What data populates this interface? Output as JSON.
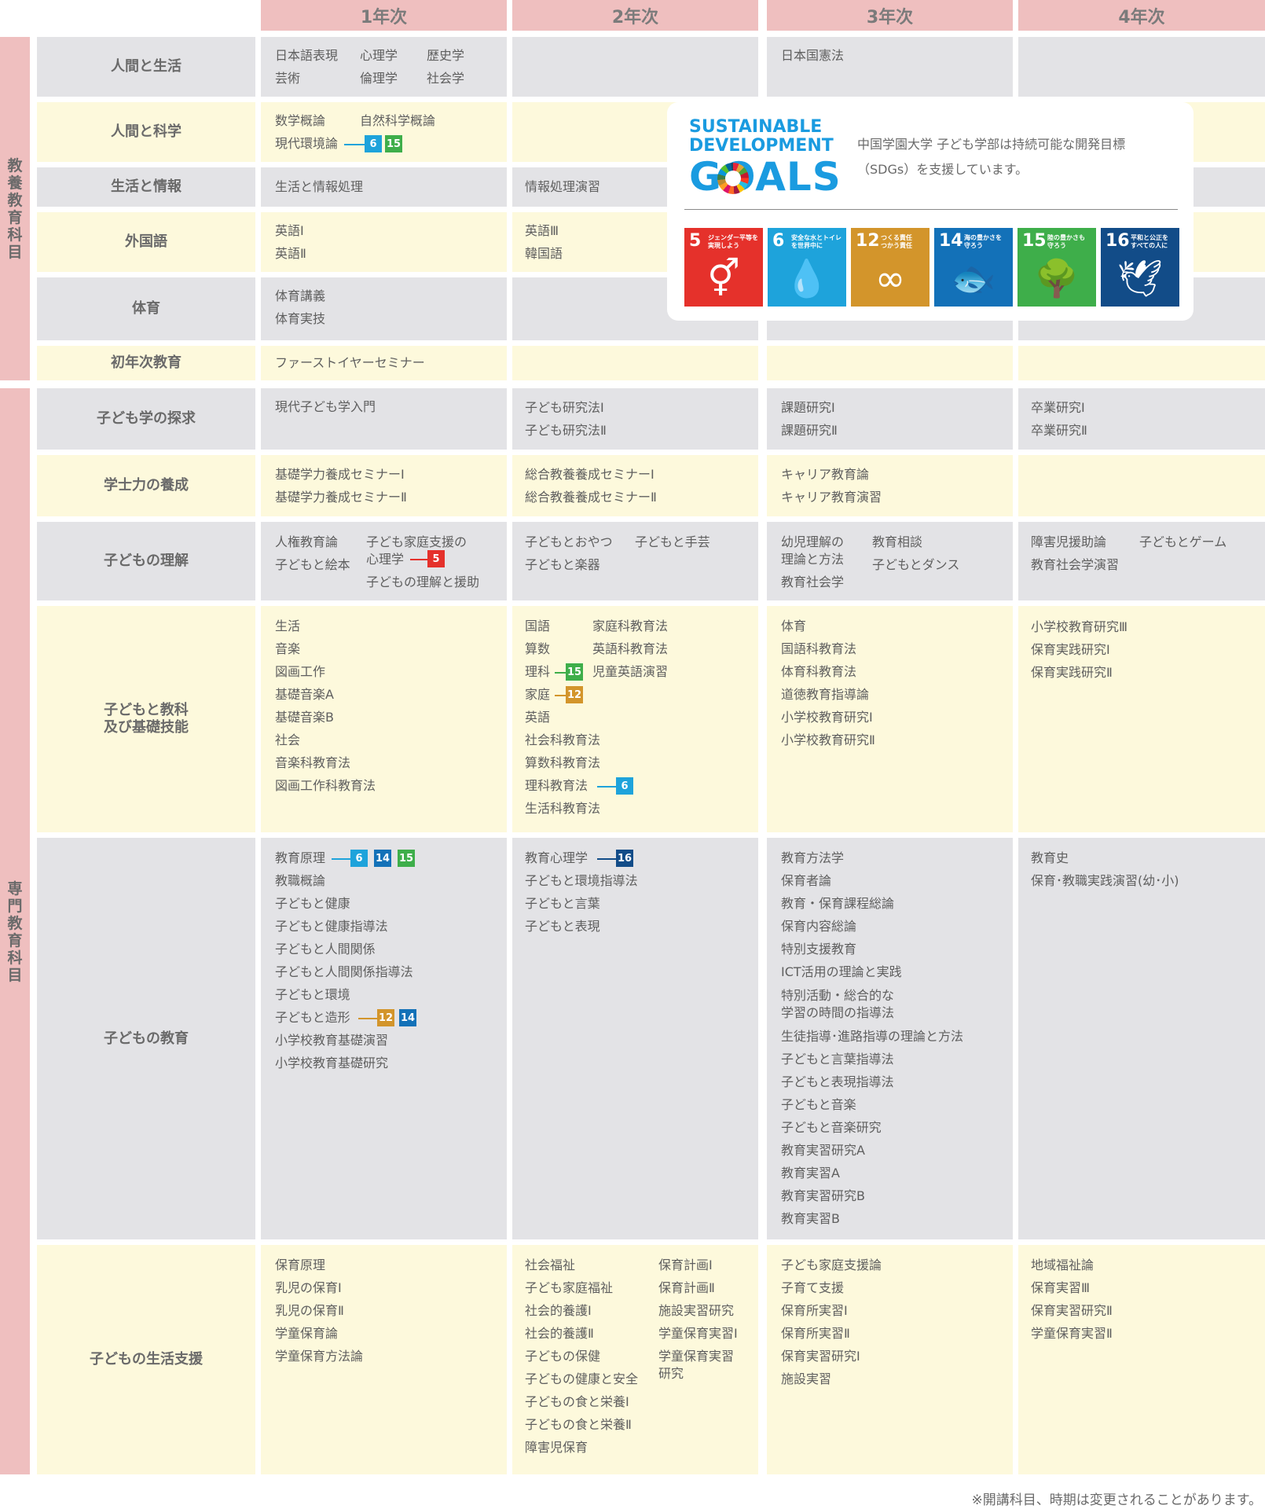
{
  "years": [
    "1年次",
    "2年次",
    "3年次",
    "4年次"
  ],
  "groups": [
    {
      "label": "教養教育科目",
      "chars": [
        "教",
        "養",
        "教",
        "育",
        "科",
        "目"
      ]
    },
    {
      "label": "専門教育科目",
      "chars": [
        "専",
        "門",
        "教",
        "育",
        "科",
        "目"
      ]
    }
  ],
  "categories": [
    "人間と生活",
    "人間と科学",
    "生活と情報",
    "外国語",
    "体育",
    "初年次教育",
    "子ども学の探求",
    "学士力の養成",
    "子どもの理解",
    "子どもと教科",
    "及び基礎技能",
    "子どもの教育",
    "子どもの生活支援"
  ],
  "cells": {
    "r1y1": [
      "日本語表現",
      "心理学",
      "歴史学",
      "芸術",
      "倫理学",
      "社会学"
    ],
    "r1y3": [
      "日本国憲法"
    ],
    "r2y1": [
      "数学概論",
      "自然科学概論",
      "現代環境論"
    ],
    "r3y1": [
      "生活と情報処理"
    ],
    "r3y2": [
      "情報処理演習"
    ],
    "r4y1": [
      "英語Ⅰ",
      "英語Ⅱ"
    ],
    "r4y2": [
      "英語Ⅲ",
      "韓国語"
    ],
    "r5y1": [
      "体育講義",
      "体育実技"
    ],
    "r6y1": [
      "ファーストイヤーセミナー"
    ],
    "r7y1": [
      "現代子ども学入門"
    ],
    "r7y2": [
      "子ども研究法Ⅰ",
      "子ども研究法Ⅱ"
    ],
    "r7y3": [
      "課題研究Ⅰ",
      "課題研究Ⅱ"
    ],
    "r7y4": [
      "卒業研究Ⅰ",
      "卒業研究Ⅱ"
    ],
    "r8y1": [
      "基礎学力養成セミナーⅠ",
      "基礎学力養成セミナーⅡ"
    ],
    "r8y2": [
      "総合教養養成セミナーⅠ",
      "総合教養養成セミナーⅡ"
    ],
    "r8y3": [
      "キャリア教育論",
      "キャリア教育演習"
    ],
    "r9y1": [
      "人権教育論",
      "子ども家庭支援の",
      "子どもと絵本",
      "心理学",
      "子どもの理解と援助"
    ],
    "r9y2": [
      "子どもとおやつ",
      "子どもと手芸",
      "子どもと楽器"
    ],
    "r9y3": [
      "幼児理解の",
      "教育相談",
      "理論と方法",
      "子どもとダンス",
      "教育社会学"
    ],
    "r9y4": [
      "障害児援助論",
      "子どもとゲーム",
      "教育社会学演習"
    ],
    "r10y1": [
      "生活",
      "音楽",
      "図画工作",
      "基礎音楽A",
      "基礎音楽B",
      "社会",
      "音楽科教育法",
      "図画工作科教育法"
    ],
    "r10y2": [
      "国語",
      "家庭科教育法",
      "算数",
      "英語科教育法",
      "理科",
      "児童英語演習",
      "家庭",
      "英語",
      "社会科教育法",
      "算数科教育法",
      "理科教育法",
      "生活科教育法"
    ],
    "r10y3": [
      "体育",
      "国語科教育法",
      "体育科教育法",
      "道徳教育指導論",
      "小学校教育研究Ⅰ",
      "小学校教育研究Ⅱ"
    ],
    "r10y4": [
      "小学校教育研究Ⅲ",
      "保育実践研究Ⅰ",
      "保育実践研究Ⅱ"
    ],
    "r11y1": [
      "教育原理",
      "教職概論",
      "子どもと健康",
      "子どもと健康指導法",
      "子どもと人間関係",
      "子どもと人間関係指導法",
      "子どもと環境",
      "子どもと造形",
      "小学校教育基礎演習",
      "小学校教育基礎研究"
    ],
    "r11y2": [
      "教育心理学",
      "子どもと環境指導法",
      "子どもと言葉",
      "子どもと表現"
    ],
    "r11y3": [
      "教育方法学",
      "保育者論",
      "教育・保育課程総論",
      "保育内容総論",
      "特別支援教育",
      "ICT活用の理論と実践",
      "特別活動・総合的な",
      "学習の時間の指導法",
      "生徒指導･進路指導の理論と方法",
      "子どもと言葉指導法",
      "子どもと表現指導法",
      "子どもと音楽",
      "子どもと音楽研究",
      "教育実習研究A",
      "教育実習A",
      "教育実習研究B",
      "教育実習B"
    ],
    "r11y4": [
      "教育史",
      "保育･教職実践演習(幼･小)"
    ],
    "r12y1": [
      "保育原理",
      "乳児の保育Ⅰ",
      "乳児の保育Ⅱ",
      "学童保育論",
      "学童保育方法論"
    ],
    "r12y2": [
      "社会福祉",
      "保育計画Ⅰ",
      "子ども家庭福祉",
      "保育計画Ⅱ",
      "社会的養護Ⅰ",
      "施設実習研究",
      "社会的養護Ⅱ",
      "学童保育実習Ⅰ",
      "子どもの保健",
      "学童保育実習",
      "研究",
      "子どもの健康と安全",
      "子どもの食と栄養Ⅰ",
      "子どもの食と栄養Ⅱ",
      "障害児保育"
    ],
    "r12y3": [
      "子ども家庭支援論",
      "子育て支援",
      "保育所実習Ⅰ",
      "保育所実習Ⅱ",
      "保育実習研究Ⅰ",
      "施設実習"
    ],
    "r12y4": [
      "地域福祉論",
      "保育実習Ⅲ",
      "保育実習研究Ⅱ",
      "学童保育実習Ⅱ"
    ]
  },
  "badges": [
    "6",
    "15",
    "5",
    "15",
    "12",
    "6",
    "6",
    "14",
    "15",
    "16",
    "12",
    "14"
  ],
  "sdg_colors": {
    "5": "#e5312b",
    "6": "#1ea3db",
    "12": "#d3952b",
    "14": "#1371b8",
    "15": "#3eae4a",
    "16": "#124c88"
  },
  "sdgs_panel": {
    "logo_line1": "SUSTAINABLE",
    "logo_line2": "DEVELOPMENT",
    "logo_line3": "GOALS",
    "text1": "中国学園大学 子ども学部は持続可能な開発目標",
    "text2": "（SDGs）を支援しています。",
    "tiles": [
      {
        "num": "5",
        "caption1": "ジェンダー平等を",
        "caption2": "実現しよう",
        "icon": "gender-equality-icon",
        "color": "#e5312b",
        "glyph": "⚥"
      },
      {
        "num": "6",
        "caption1": "安全な水とトイレ",
        "caption2": "を世界中に",
        "icon": "water-drop-icon",
        "color": "#1ea3db",
        "glyph": "💧"
      },
      {
        "num": "12",
        "caption1": "つくる責任",
        "caption2": "つかう責任",
        "icon": "infinity-icon",
        "color": "#d3952b",
        "glyph": "∞"
      },
      {
        "num": "14",
        "caption1": "海の豊かさを",
        "caption2": "守ろう",
        "icon": "fish-icon",
        "color": "#1371b8",
        "glyph": "🐟"
      },
      {
        "num": "15",
        "caption1": "陸の豊かさも",
        "caption2": "守ろう",
        "icon": "tree-icon",
        "color": "#3eae4a",
        "glyph": "🌳"
      },
      {
        "num": "16",
        "caption1": "平和と公正を",
        "caption2": "すべての人に",
        "icon": "dove-icon",
        "color": "#124c88",
        "glyph": "🕊"
      }
    ]
  },
  "note": "※開講科目、時期は変更されることがあります。"
}
